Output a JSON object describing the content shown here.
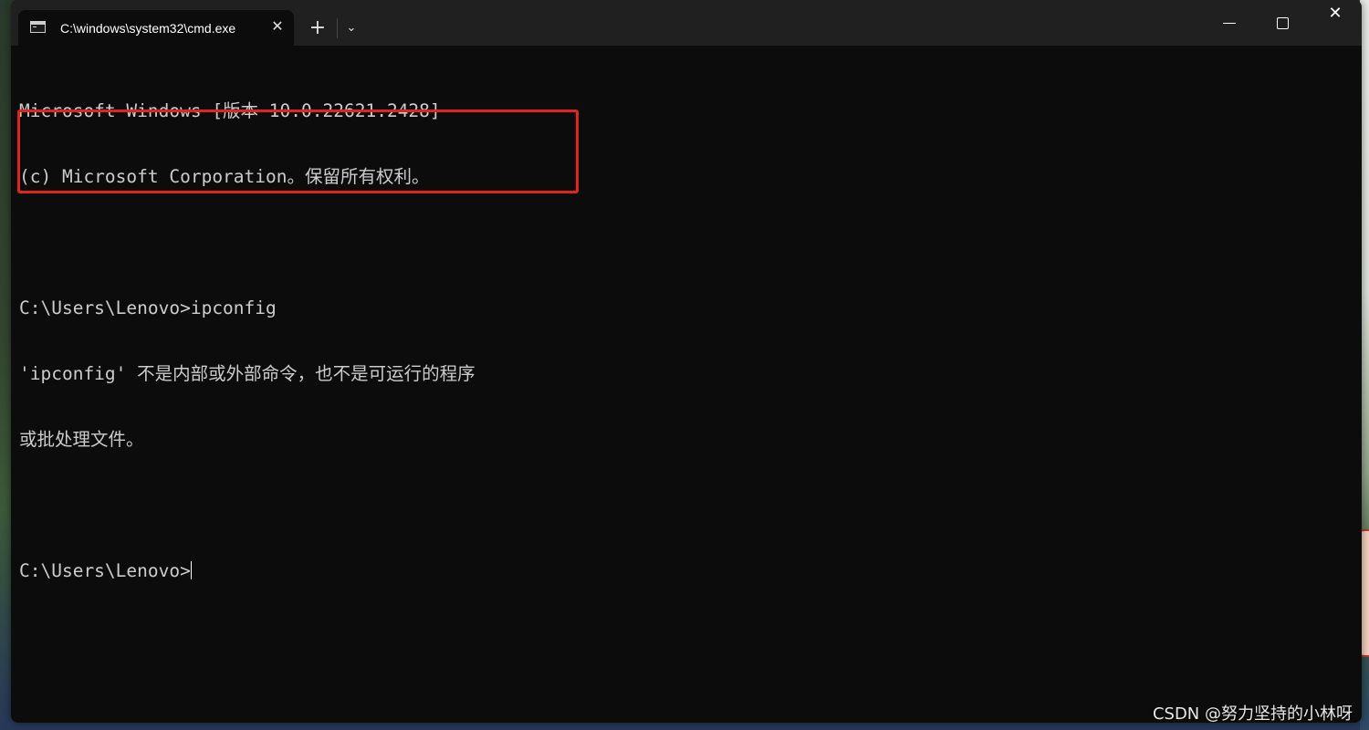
{
  "window": {
    "tab_title": "C:\\windows\\system32\\cmd.exe",
    "tab_close_glyph": "✕",
    "new_tab_glyph": "+",
    "dropdown_glyph": "⌄",
    "close_glyph": "✕"
  },
  "console": {
    "lines": [
      "Microsoft Windows [版本 10.0.22621.2428]",
      "(c) Microsoft Corporation。保留所有权利。",
      "",
      "C:\\Users\\Lenovo>ipconfig",
      "'ipconfig' 不是内部或外部命令，也不是可运行的程序",
      "或批处理文件。",
      "",
      "C:\\Users\\Lenovo>"
    ]
  },
  "annotation": {
    "highlight_color": "#e0251b"
  },
  "watermark": "CSDN @努力坚持的小林呀",
  "colors": {
    "terminal_bg": "#0c0c0c",
    "terminal_text": "#cccccc",
    "titlebar_bg": "#202020"
  }
}
